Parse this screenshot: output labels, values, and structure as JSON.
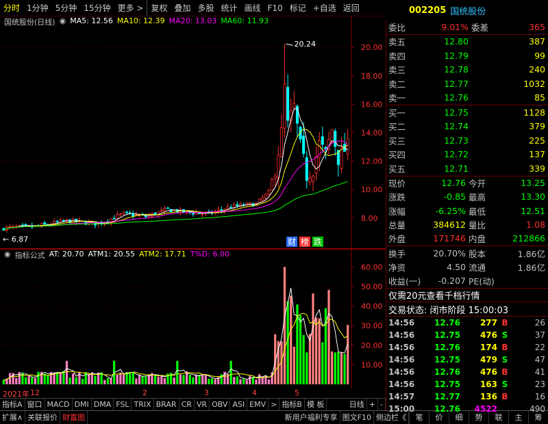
{
  "toolbar": [
    "分时",
    "1分钟",
    "5分钟",
    "15分钟",
    "更多 >",
    "复权",
    "叠加",
    "多股",
    "统计",
    "画线",
    "F10",
    "标记",
    "+自选",
    "返回"
  ],
  "stock": {
    "code": "002205",
    "name": "国统股份"
  },
  "main_legend": {
    "title": "国统股份(日线)",
    "ma5": "MA5: 12.56",
    "ma10": "MA10: 12.39",
    "ma20": "MA20: 13.03",
    "ma60": "MA60: 11.93"
  },
  "main_annotations": {
    "high": "20.24",
    "low": "6.87",
    "badges": [
      "财",
      "榜",
      "跌"
    ]
  },
  "ind_legend": {
    "title": "指标公式",
    "at": "AT: 20.70",
    "atm1": "ATM1: 20.55",
    "atm2": "ATM2: 17.71",
    "td": "T%D: 6.00"
  },
  "colors": {
    "up": "#ff3030",
    "down": "#00ff00",
    "ma5": "#ffffff",
    "ma10": "#ffff00",
    "ma20": "#ff00ff",
    "ma60": "#00ff00",
    "grid": "#6b0000"
  },
  "chart_data": [
    {
      "type": "candlestick",
      "title": "国统股份(日线)",
      "ylim": [
        6.5,
        21.5
      ],
      "y_ticks": [
        "20.00",
        "18.00",
        "16.00",
        "14.00",
        "12.00",
        "10.00",
        "8.00"
      ],
      "series": [
        {
          "name": "MA5",
          "last": 12.56
        },
        {
          "name": "MA10",
          "last": 12.39
        },
        {
          "name": "MA20",
          "last": 13.03
        },
        {
          "name": "MA60",
          "last": 11.93
        }
      ]
    },
    {
      "type": "bar",
      "title": "指标公式",
      "ylim": [
        0,
        65
      ],
      "y_ticks": [
        "60.00",
        "50.00",
        "40.00",
        "30.00",
        "20.00",
        "10.00"
      ]
    }
  ],
  "date_axis": [
    "2021年",
    "12",
    "2",
    "3",
    "4",
    "5"
  ],
  "ind_tabs": [
    "指标A",
    "窗口",
    "MACD",
    "DMI",
    "DMA",
    "FSL",
    "TRIX",
    "BRAR",
    "CR",
    "VR",
    "OBV",
    "ASI",
    "EMV",
    ">",
    "指标B",
    "模 板",
    "日线",
    "+",
    "-"
  ],
  "bottom_bar": {
    "left": [
      "扩展∧",
      "关联报价",
      "财富图"
    ],
    "mid": [
      "新用户福利专享",
      "图文F10",
      "侧边栏《"
    ],
    "right": [
      "笔",
      "价",
      "细",
      "势",
      "联",
      "主",
      "筹"
    ]
  },
  "order_ratio": {
    "label1": "委比",
    "value1": "9.01%",
    "label2": "委差",
    "value2": "365"
  },
  "asks": [
    {
      "label": "卖五",
      "price": "12.80",
      "vol": "387"
    },
    {
      "label": "卖四",
      "price": "12.79",
      "vol": "99"
    },
    {
      "label": "卖三",
      "price": "12.78",
      "vol": "240"
    },
    {
      "label": "卖二",
      "price": "12.77",
      "vol": "1032"
    },
    {
      "label": "卖一",
      "price": "12.76",
      "vol": "85"
    }
  ],
  "bids": [
    {
      "label": "买一",
      "price": "12.75",
      "vol": "1128"
    },
    {
      "label": "买二",
      "price": "12.74",
      "vol": "379"
    },
    {
      "label": "买三",
      "price": "12.73",
      "vol": "225"
    },
    {
      "label": "买四",
      "price": "12.72",
      "vol": "137"
    },
    {
      "label": "买五",
      "price": "12.71",
      "vol": "339"
    }
  ],
  "stats": [
    {
      "l1": "现价",
      "v1": "12.76",
      "c1": "#00ff00",
      "l2": "今开",
      "v2": "13.25",
      "c2": "#00ff00"
    },
    {
      "l1": "涨跌",
      "v1": "-0.85",
      "c1": "#00ff00",
      "l2": "最高",
      "v2": "13.30",
      "c2": "#00ff00"
    },
    {
      "l1": "涨幅",
      "v1": "-6.25%",
      "c1": "#00ff00",
      "l2": "最低",
      "v2": "12.51",
      "c2": "#00ff00"
    },
    {
      "l1": "总量",
      "v1": "384612",
      "c1": "#ffff00",
      "l2": "量比",
      "v2": "1.08",
      "c2": "#ff3030"
    },
    {
      "l1": "外盘",
      "v1": "171746",
      "c1": "#ff3030",
      "l2": "内盘",
      "v2": "212866",
      "c2": "#00ff00"
    }
  ],
  "stats2": [
    {
      "l1": "换手",
      "v1": "20.70%",
      "c1": "#c0c0c0",
      "l2": "股本",
      "v2": "1.86亿",
      "c2": "#c0c0c0"
    },
    {
      "l1": "净资",
      "v1": "4.50",
      "c1": "#c0c0c0",
      "l2": "流通",
      "v2": "1.86亿",
      "c2": "#c0c0c0"
    },
    {
      "l1": "收益(一)",
      "v1": "-0.207",
      "c1": "#c0c0c0",
      "l2": "PE(动)",
      "v2": "",
      "c2": "#c0c0c0"
    }
  ],
  "promo": "仅需20元查看千档行情",
  "trade_status": "交易状态: 闭市阶段 15:00:03",
  "ticks": [
    {
      "t": "14:56",
      "p": "12.76",
      "q": "277",
      "d": "B",
      "n": "26"
    },
    {
      "t": "14:56",
      "p": "12.75",
      "q": "476",
      "d": "S",
      "n": "37"
    },
    {
      "t": "14:56",
      "p": "12.76",
      "q": "174",
      "d": "B",
      "n": "22"
    },
    {
      "t": "14:56",
      "p": "12.75",
      "q": "479",
      "d": "S",
      "n": "47"
    },
    {
      "t": "14:56",
      "p": "12.76",
      "q": "476",
      "d": "B",
      "n": "41"
    },
    {
      "t": "14:56",
      "p": "12.75",
      "q": "163",
      "d": "S",
      "n": "23"
    },
    {
      "t": "14:57",
      "p": "12.77",
      "q": "136",
      "d": "B",
      "n": "16"
    },
    {
      "t": "15:00",
      "p": "12.76",
      "q": "4522",
      "d": "",
      "n": "490"
    }
  ]
}
